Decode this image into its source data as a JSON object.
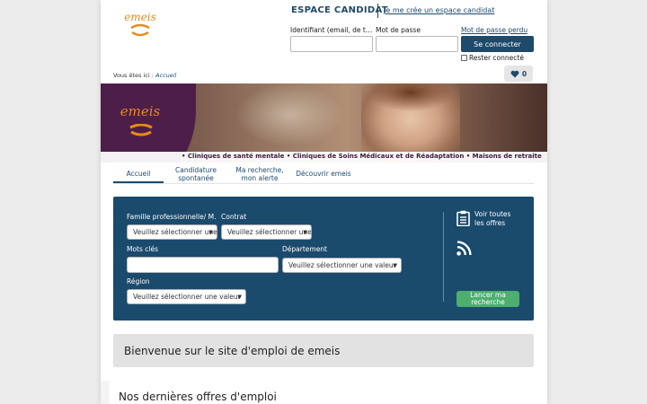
{
  "header": {
    "logo_text": "emeis",
    "espace_title": "ESPACE CANDIDAT",
    "create_account_link": "Je me crée un espace candidat",
    "identifiant_label": "Identifiant (email, de ty…",
    "password_label": "Mot de passe",
    "lost_password_link": "Mot de passe perdu",
    "connect_button": "Se connecter",
    "remember_label": "Rester connecté",
    "favorites_count": "0"
  },
  "breadcrumb": {
    "prefix": "Vous êtes ici :",
    "current": "Accueil"
  },
  "banner": {
    "logo_text": "emeis",
    "tagline": "• Cliniques de santé mentale • Cliniques de Soins Médicaux et de Réadaptation • Maisons de retraite"
  },
  "nav": {
    "items": [
      {
        "label": "Accueil"
      },
      {
        "label_line1": "Candidature",
        "label_line2": "spontanée"
      },
      {
        "label_line1": "Ma recherche,",
        "label_line2": "mon alerte"
      },
      {
        "label": "Découvrir emeis"
      }
    ]
  },
  "search": {
    "famille_label": "Famille professionnelle/ M…",
    "contrat_label": "Contrat",
    "mots_cles_label": "Mots clés",
    "departement_label": "Département",
    "region_label": "Région",
    "select_placeholder": "Veuillez sélectionner une valeur",
    "voir_offres_line1": "Voir toutes",
    "voir_offres_line2": "les offres",
    "launch_line1": "Lancer ma",
    "launch_line2": "recherche"
  },
  "main": {
    "welcome": "Bienvenue sur le site d'emploi de emeis",
    "latest_offers_title": "Nos dernières offres d'emploi"
  },
  "colors": {
    "primary": "#1e4a6b",
    "panel": "#1a4a6c",
    "accent_green": "#4caf6e",
    "brand_orange": "#e88a1a",
    "brand_purple": "#4d1e4a"
  },
  "icons": {
    "heart": "heart-icon",
    "clipboard": "clipboard-icon",
    "rss": "rss-icon",
    "dropdown": "chevron-down-icon"
  }
}
